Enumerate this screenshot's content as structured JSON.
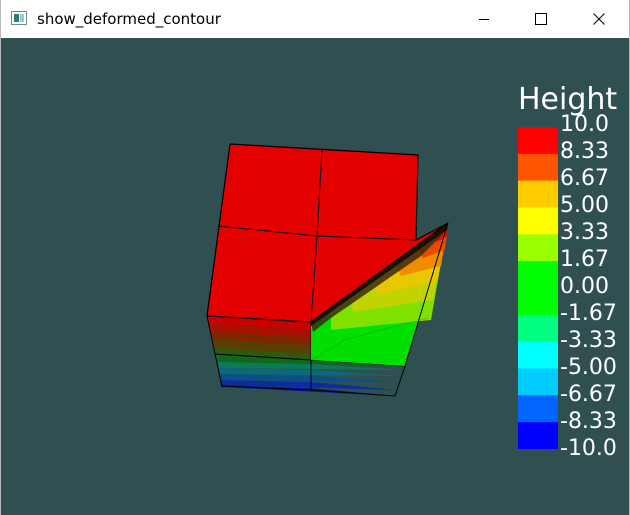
{
  "window": {
    "title": "show_deformed_contour",
    "controls": {
      "minimize": "minimize-icon",
      "maximize": "maximize-icon",
      "close": "close-icon"
    }
  },
  "viewport": {
    "background": "#304f50"
  },
  "legend": {
    "title": "Height",
    "labels": [
      "10.0",
      "8.33",
      "6.67",
      "5.00",
      "3.33",
      "1.67",
      "0.00",
      "-1.67",
      "-3.33",
      "-5.00",
      "-6.67",
      "-8.33",
      "-10.0"
    ],
    "colors": [
      "#ff0000",
      "#ff5500",
      "#ffcc00",
      "#ffff00",
      "#99ff00",
      "#00ff00",
      "#00ff00",
      "#00ff80",
      "#00ffff",
      "#00ccff",
      "#0066ff",
      "#0000ff"
    ]
  }
}
